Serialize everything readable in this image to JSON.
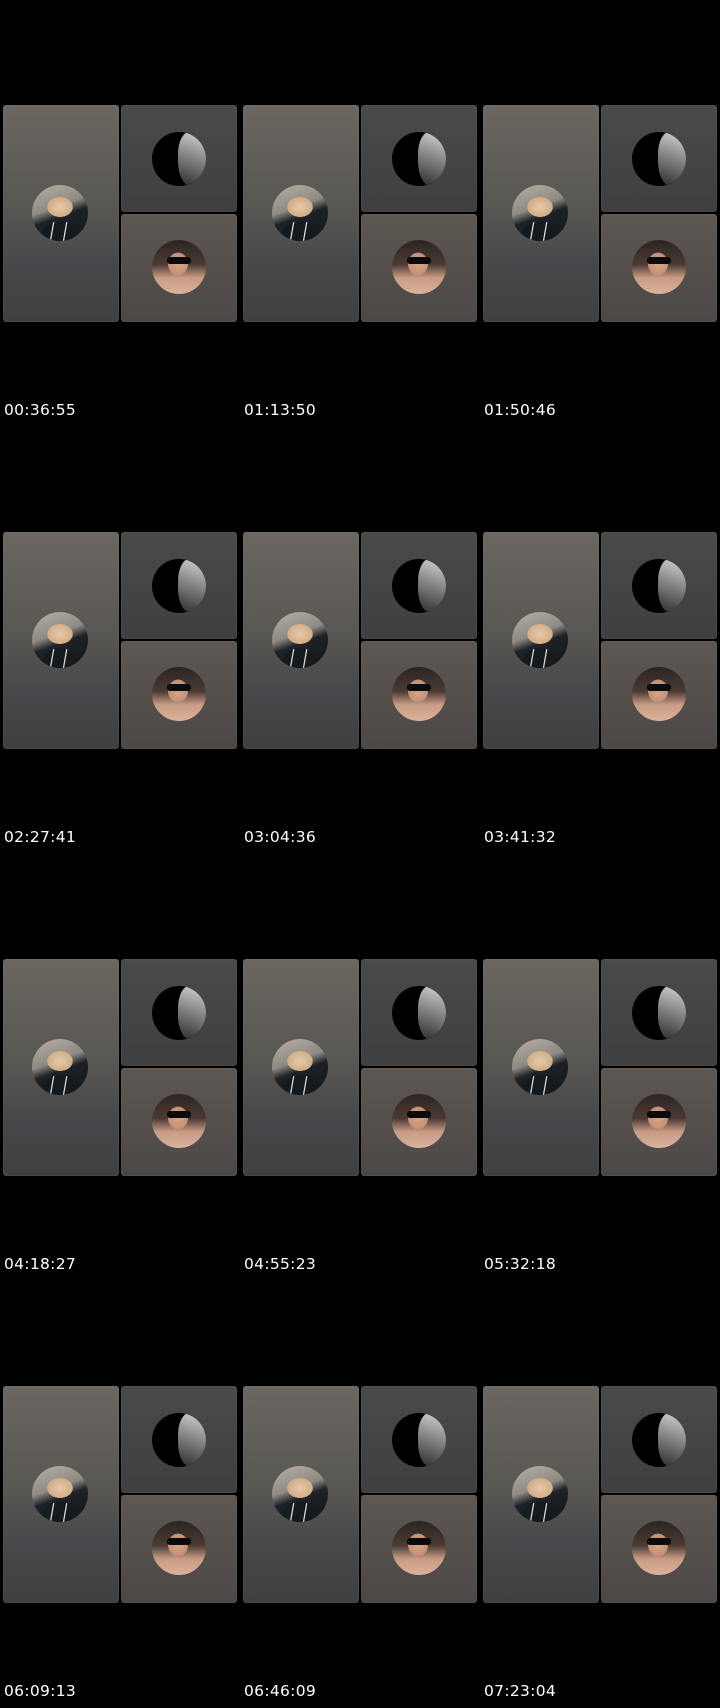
{
  "thumbnails": [
    {
      "time": "00:36:55"
    },
    {
      "time": "01:13:50"
    },
    {
      "time": "01:50:46"
    },
    {
      "time": "02:27:41"
    },
    {
      "time": "03:04:36"
    },
    {
      "time": "03:41:32"
    },
    {
      "time": "04:18:27"
    },
    {
      "time": "04:55:23"
    },
    {
      "time": "05:32:18"
    },
    {
      "time": "06:09:13"
    },
    {
      "time": "06:46:09"
    },
    {
      "time": "07:23:04"
    }
  ]
}
